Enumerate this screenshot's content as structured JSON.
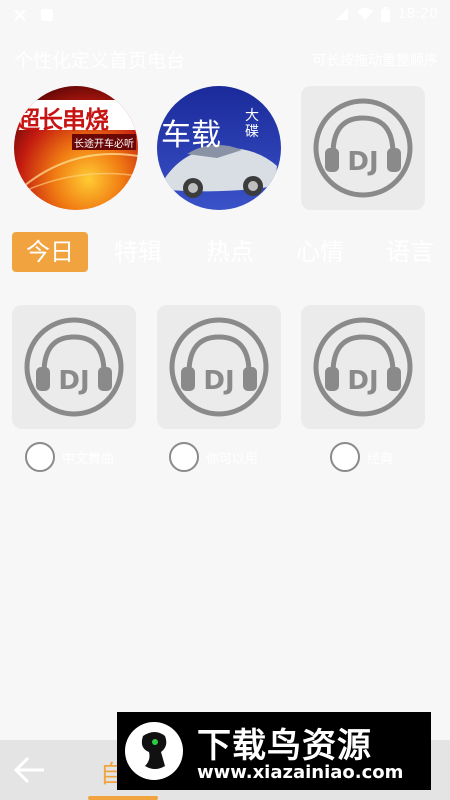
{
  "status_bar": {
    "time": "18:20"
  },
  "header": {
    "title": "个性化定义首页电台",
    "hint": "可长按拖动重整顺序"
  },
  "top_row": [
    {
      "title_text": "超长串烧",
      "subtitle": "长途开车必听"
    },
    {
      "title_text": "车载",
      "side_text": "大碟"
    },
    {
      "dj_text": "DJ"
    }
  ],
  "tabs": [
    {
      "label": "今日"
    },
    {
      "label": "特辑"
    },
    {
      "label": "热点"
    },
    {
      "label": "心情"
    },
    {
      "label": "语言"
    }
  ],
  "grid_items": [
    {
      "dj_text": "DJ",
      "label": "中文舞曲"
    },
    {
      "dj_text": "DJ",
      "label": "你可以用"
    },
    {
      "dj_text": "DJ",
      "label": "经典"
    }
  ],
  "bottom_bar": {
    "title": "自定义"
  },
  "watermark": {
    "text": "下载鸟资源",
    "url": "www.xiazainiao.com"
  },
  "colors": {
    "accent": "#f0a33e",
    "tile_bg": "#ebebeb",
    "headphone": "#8a8a8a"
  }
}
